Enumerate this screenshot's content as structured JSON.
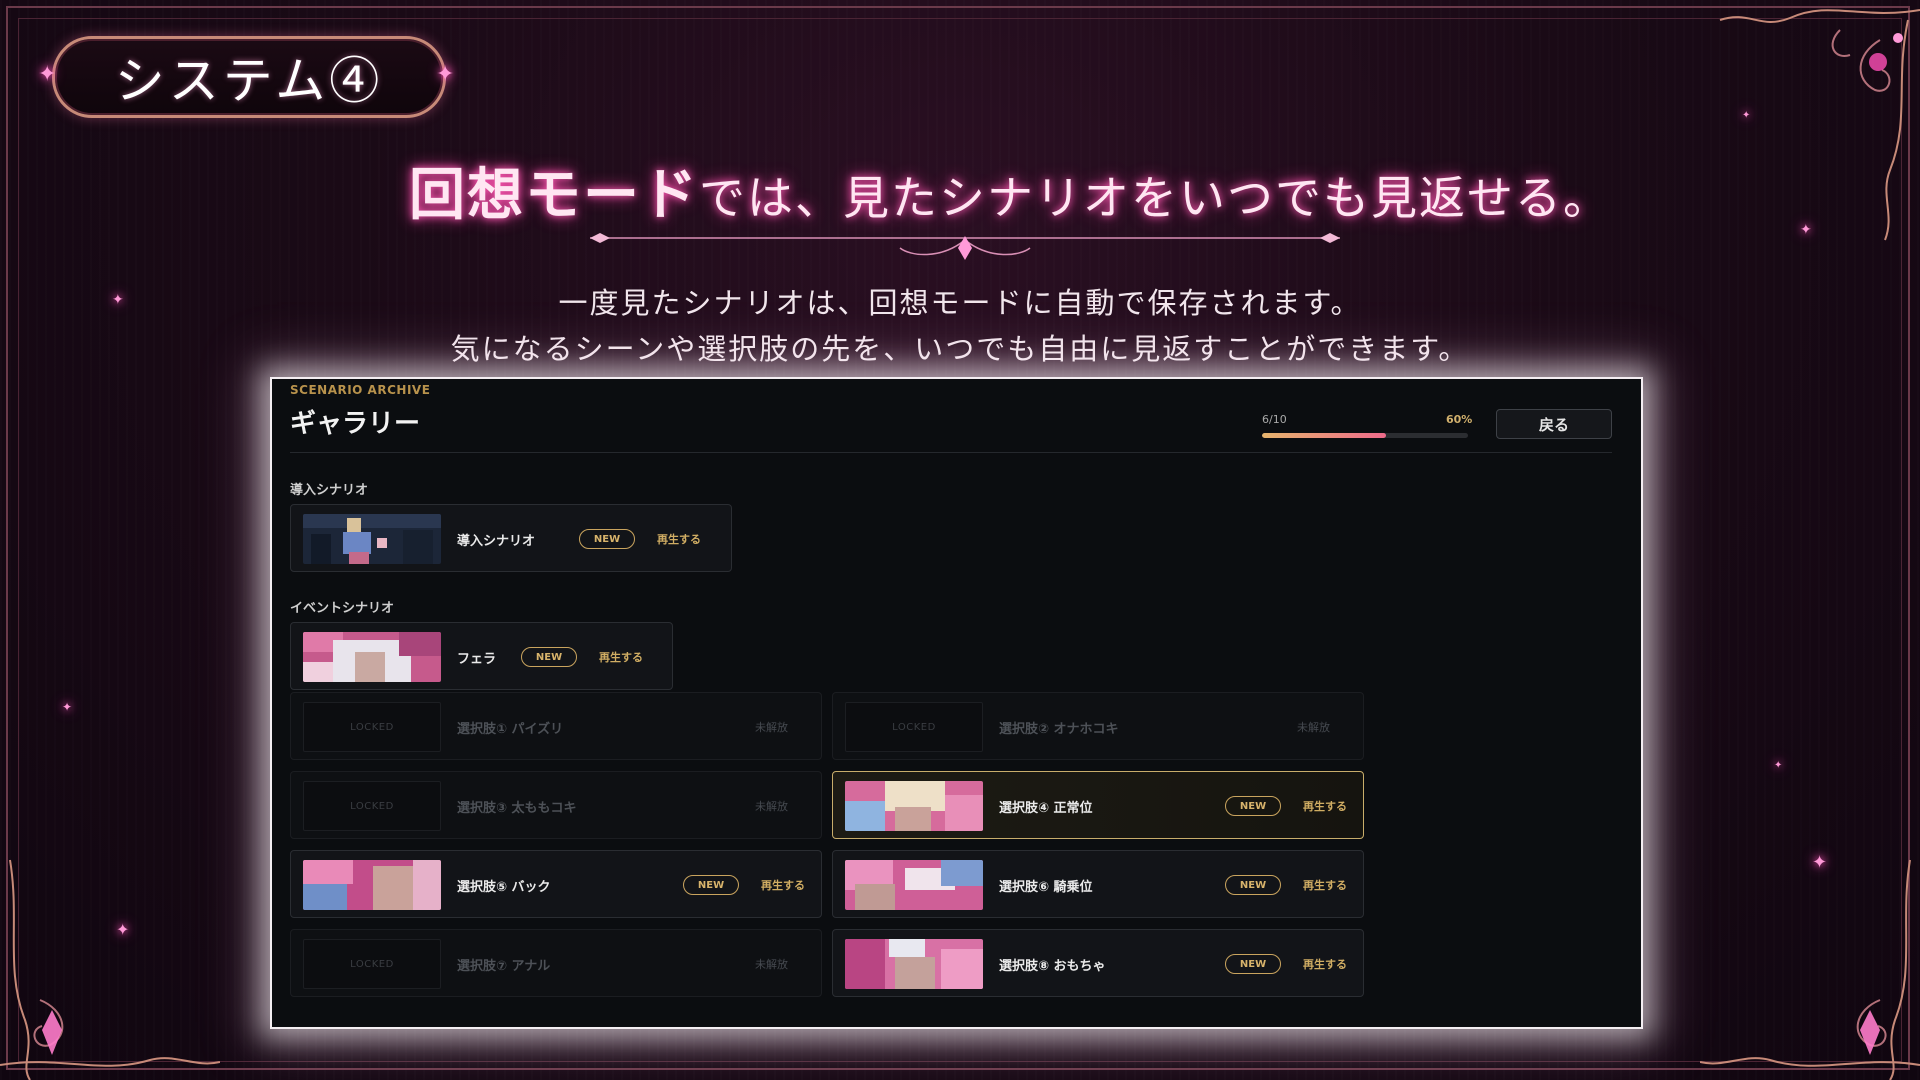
{
  "slide": {
    "section_title": "システム④",
    "headline_strong": "回想モード",
    "headline_rest": "では、見たシナリオをいつでも見返せる。",
    "desc_line1": "一度見たシナリオは、回想モードに自動で保存されます。",
    "desc_line2": "気になるシーンや選択肢の先を、いつでも自由に見返すことができます。"
  },
  "gallery": {
    "archive_label": "SCENARIO ARCHIVE",
    "title": "ギャラリー",
    "progress_count": "6/10",
    "progress_percent_text": "60%",
    "progress_value": 0.6,
    "back_label": "戻る",
    "sections": [
      {
        "label": "導入シナリオ"
      },
      {
        "label": "イベントシナリオ"
      }
    ],
    "new_label": "NEW",
    "play_label": "再生する",
    "locked_thumb_label": "LOCKED",
    "locked_status_label": "未解放",
    "intro_card": {
      "title": "導入シナリオ",
      "unlocked": true
    },
    "event_card": {
      "title": "フェラ",
      "unlocked": true
    },
    "choice_cards": [
      {
        "title": "選択肢① パイズリ",
        "unlocked": false
      },
      {
        "title": "選択肢② オナホコキ",
        "unlocked": false
      },
      {
        "title": "選択肢③ 太ももコキ",
        "unlocked": false
      },
      {
        "title": "選択肢④ 正常位",
        "unlocked": true,
        "highlighted": true
      },
      {
        "title": "選択肢⑤ バック",
        "unlocked": true
      },
      {
        "title": "選択肢⑥ 騎乗位",
        "unlocked": true
      },
      {
        "title": "選択肢⑦ アナル",
        "unlocked": false
      },
      {
        "title": "選択肢⑧ おもちゃ",
        "unlocked": true
      }
    ]
  },
  "colors": {
    "accent_gold": "#c9a45e",
    "glow_pink": "#ff5ab4",
    "panel_bg": "#0b0d10"
  }
}
